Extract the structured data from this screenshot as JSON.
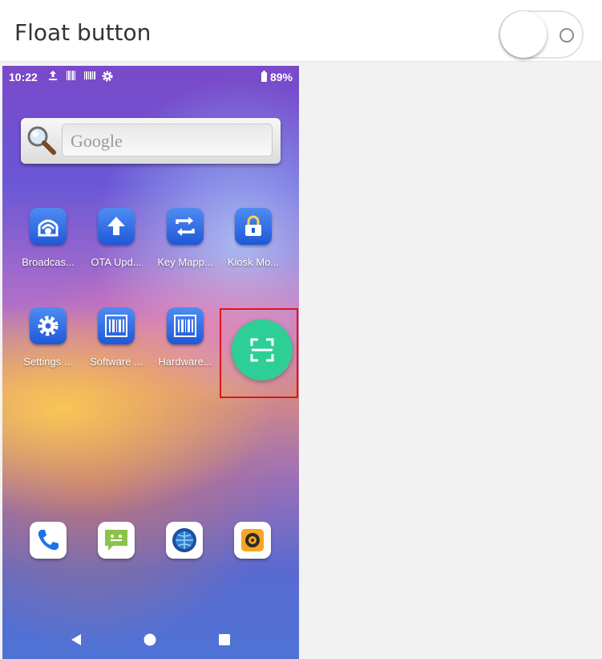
{
  "settings": {
    "title": "Float button",
    "toggle_state": "off"
  },
  "phone": {
    "status_bar": {
      "time": "10:22",
      "icons": [
        "upload-icon",
        "barcode-icon",
        "barcode-icon",
        "gear-icon"
      ],
      "battery": "89%"
    },
    "search": {
      "placeholder": "Google"
    },
    "apps_row1": [
      {
        "label": "Broadcas...",
        "icon": "broadcast-icon"
      },
      {
        "label": "OTA Upd...",
        "icon": "upload-arrow-icon"
      },
      {
        "label": "Key Mapp...",
        "icon": "swap-arrows-icon"
      },
      {
        "label": "Kiosk Mo...",
        "icon": "lock-icon"
      }
    ],
    "apps_row2": [
      {
        "label": "Settings ...",
        "icon": "gear-icon"
      },
      {
        "label": "Software ...",
        "icon": "barcode-icon"
      },
      {
        "label": "Hardware...",
        "icon": "barcode-icon"
      }
    ],
    "float_button": {
      "icon": "scan-frame-icon",
      "color": "#2ecf97"
    },
    "dock": [
      "phone-icon",
      "messages-icon",
      "browser-icon",
      "camera-icon"
    ],
    "nav": [
      "back-icon",
      "home-icon",
      "recents-icon"
    ],
    "highlight_color": "#e0141c"
  }
}
